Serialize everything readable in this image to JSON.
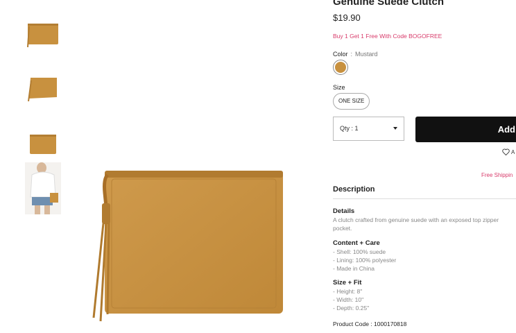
{
  "product": {
    "title": "Genuine Suede Clutch",
    "price": "$19.90",
    "promo": "Buy 1 Get 1 Free With Code BOGOFREE",
    "color_label": "Color",
    "color_sep": ":",
    "color_value": "Mustard",
    "swatch_color": "#c8913f",
    "size_label": "Size",
    "size_option": "ONE SIZE",
    "qty_label": "Qty : 1",
    "add_button": "Add",
    "wishlist_partial": "A",
    "free_shipping_partial": "Free Shippin",
    "product_code": "Product Code : 1000170818"
  },
  "description": {
    "heading": "Description",
    "details_heading": "Details",
    "details_line1": "A clutch crafted from genuine suede with an exposed top zipper",
    "details_line2": "pocket.",
    "content_heading": "Content + Care",
    "content_lines": [
      "- Shell: 100% suede",
      "- Lining: 100% polyester",
      "- Made in China"
    ],
    "size_fit_heading": "Size + Fit",
    "size_fit_lines": [
      "- Height: 8\"",
      "- Width: 10\"",
      "- Depth: 0.25\""
    ]
  },
  "thumbnails": [
    {
      "name": "clutch-front"
    },
    {
      "name": "clutch-angle"
    },
    {
      "name": "clutch-back"
    },
    {
      "name": "model-wearing"
    }
  ],
  "colors": {
    "accent_pink": "#d83a6a",
    "button_black": "#111111",
    "suede": "#c8913f"
  }
}
